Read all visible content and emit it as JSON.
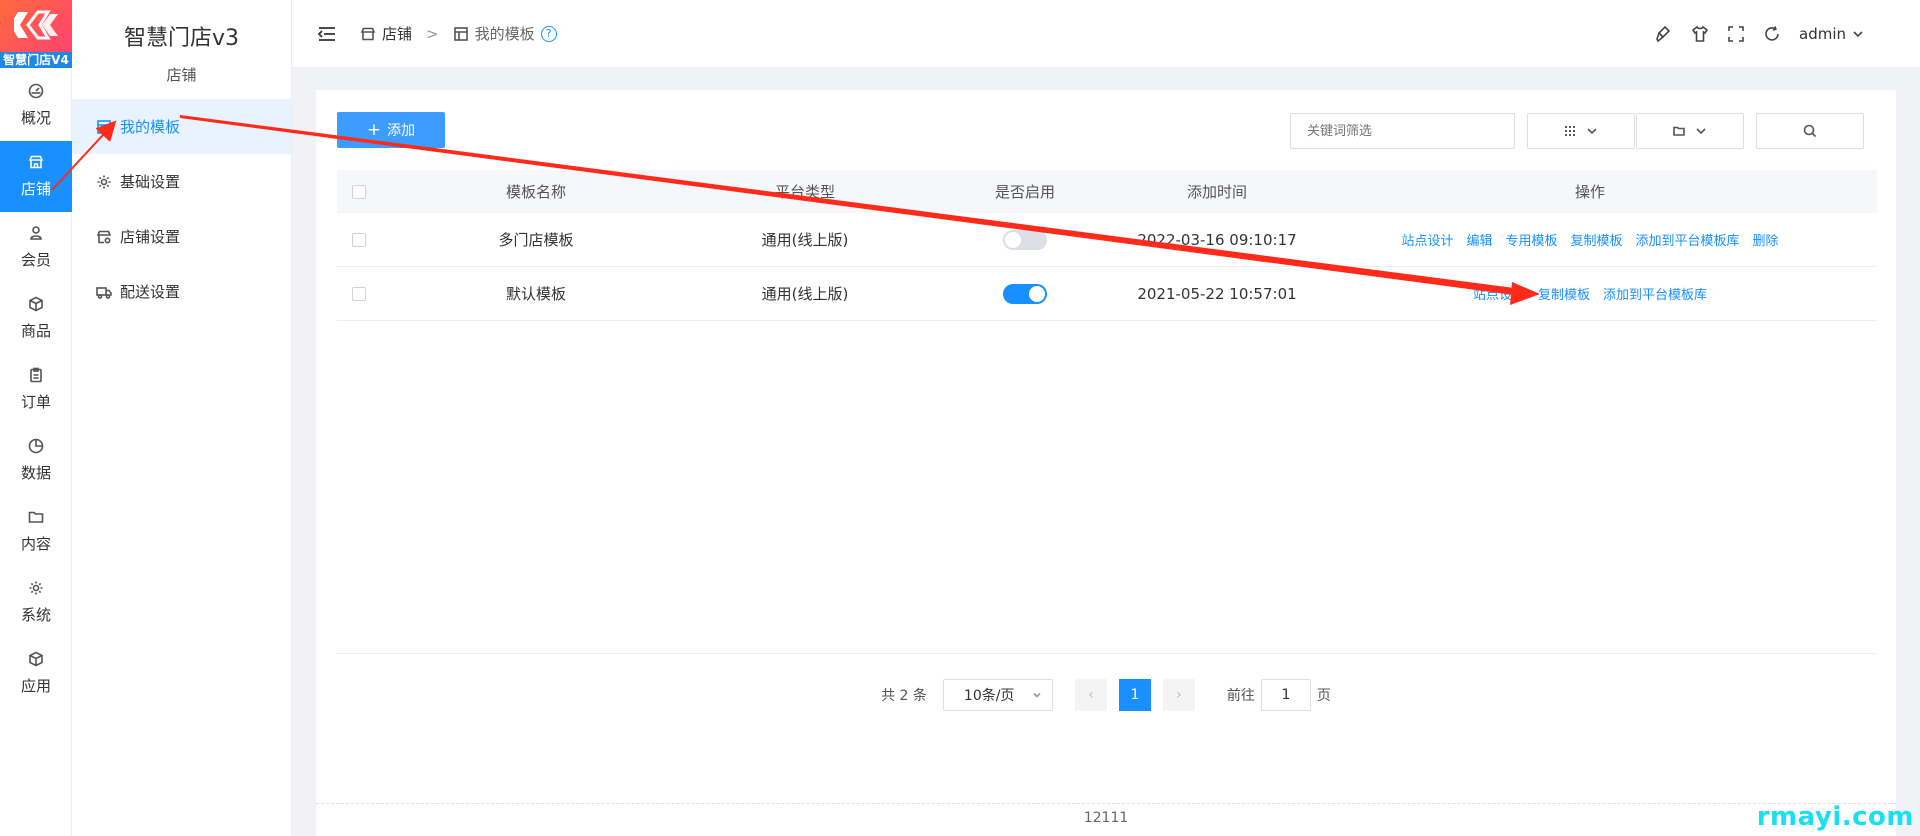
{
  "app": {
    "logo_text": "智慧门店V4",
    "title": "智慧门店v3",
    "subtitle": "店铺"
  },
  "rail": [
    {
      "label": "概况",
      "icon": "dashboard-icon"
    },
    {
      "label": "店铺",
      "icon": "shop-icon",
      "active": true
    },
    {
      "label": "会员",
      "icon": "user-icon"
    },
    {
      "label": "商品",
      "icon": "box-icon"
    },
    {
      "label": "订单",
      "icon": "clipboard-icon"
    },
    {
      "label": "数据",
      "icon": "pie-icon"
    },
    {
      "label": "内容",
      "icon": "folder-icon"
    },
    {
      "label": "系统",
      "icon": "gear-icon"
    },
    {
      "label": "应用",
      "icon": "cube-icon"
    }
  ],
  "subnav": [
    {
      "label": "我的模板",
      "icon": "template-icon",
      "active": true
    },
    {
      "label": "基础设置",
      "icon": "gear-icon"
    },
    {
      "label": "店铺设置",
      "icon": "shop-settings-icon"
    },
    {
      "label": "配送设置",
      "icon": "truck-icon"
    }
  ],
  "breadcrumb": {
    "root": "店铺",
    "separator": ">",
    "current": "我的模板",
    "help": "?"
  },
  "topbar": {
    "user": "admin"
  },
  "toolbar": {
    "add_label": "添加",
    "filter_placeholder": "关键词筛选"
  },
  "table": {
    "columns": [
      "模板名称",
      "平台类型",
      "是否启用",
      "添加时间",
      "操作"
    ],
    "rows": [
      {
        "name": "多门店模板",
        "platform": "通用(线上版)",
        "enabled": false,
        "added": "2022-03-16 09:10:17",
        "actions": [
          "站点设计",
          "编辑",
          "专用模板",
          "复制模板",
          "添加到平台模板库",
          "删除"
        ]
      },
      {
        "name": "默认模板",
        "platform": "通用(线上版)",
        "enabled": true,
        "added": "2021-05-22 10:57:01",
        "actions": [
          "站点设计",
          "复制模板",
          "添加到平台模板库"
        ]
      }
    ]
  },
  "pagination": {
    "total_text": "共 2 条",
    "page_size": "10条/页",
    "current_page": "1",
    "goto_prefix": "前往",
    "goto_value": "1",
    "goto_suffix": "页"
  },
  "footer": {
    "text": "12111"
  },
  "watermark": "rmayi.com",
  "colors": {
    "accent": "#1890ff",
    "annotation": "#ff2a1a"
  }
}
